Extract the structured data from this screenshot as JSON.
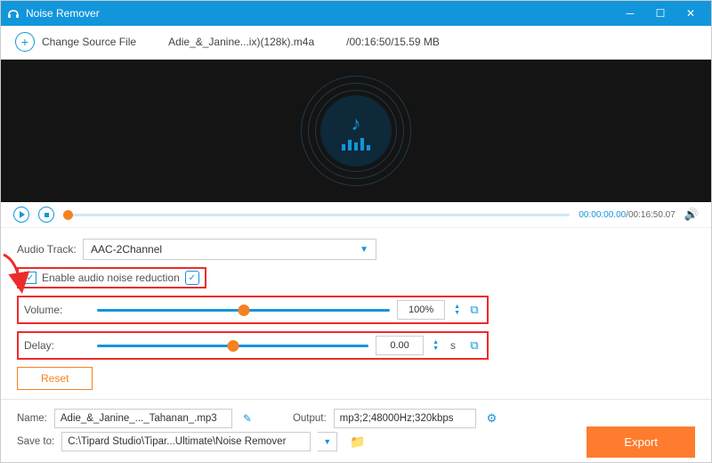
{
  "title": "Noise Remover",
  "file": {
    "change_label": "Change Source File",
    "name": "Adie_&_Janine...ix)(128k).m4a",
    "meta": "/00:16:50/15.59 MB"
  },
  "playback": {
    "time_current": "00:00:00.00",
    "time_total": "/00:16:50.07"
  },
  "controls": {
    "audio_track_label": "Audio Track:",
    "audio_track_value": "AAC-2Channel",
    "enable_noise_label": "Enable audio noise reduction",
    "volume_label": "Volume:",
    "volume_value": "100%",
    "delay_label": "Delay:",
    "delay_value": "0.00",
    "delay_unit": "s",
    "reset_label": "Reset"
  },
  "bottom": {
    "name_label": "Name:",
    "name_value": "Adie_&_Janine_..._Tahanan_.mp3",
    "output_label": "Output:",
    "output_value": "mp3;2;48000Hz;320kbps",
    "save_label": "Save to:",
    "save_value": "C:\\Tipard Studio\\Tipar...Ultimate\\Noise Remover",
    "export_label": "Export"
  }
}
